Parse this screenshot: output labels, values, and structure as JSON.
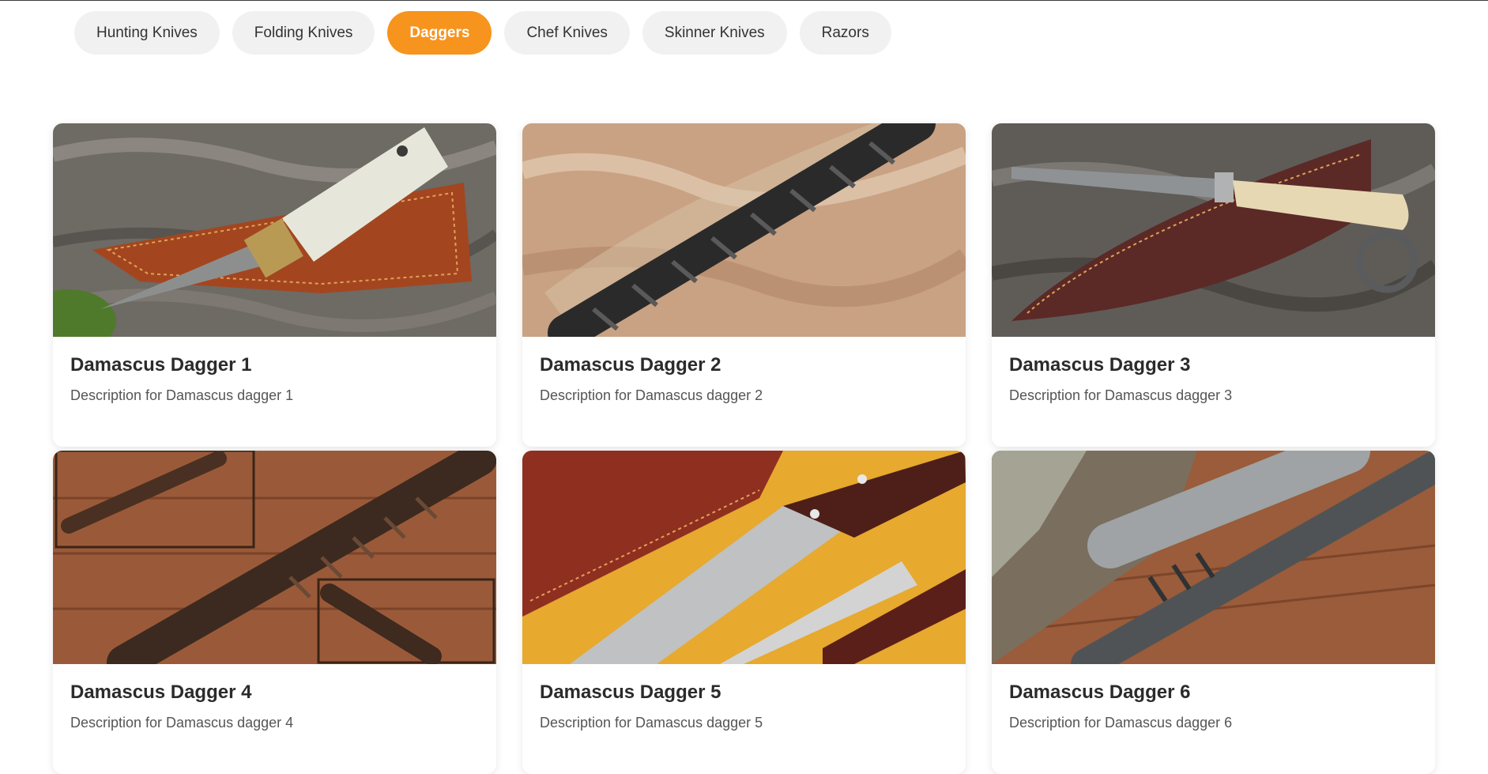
{
  "categories": [
    {
      "label": "Hunting Knives",
      "active": false
    },
    {
      "label": "Folding Knives",
      "active": false
    },
    {
      "label": "Daggers",
      "active": true
    },
    {
      "label": "Chef Knives",
      "active": false
    },
    {
      "label": "Skinner Knives",
      "active": false
    },
    {
      "label": "Razors",
      "active": false
    }
  ],
  "colors": {
    "accent": "#f7941d",
    "tab_bg": "#f1f1f1"
  },
  "products": [
    {
      "title": "Damascus Dagger 1",
      "description": "Description for Damascus dagger 1"
    },
    {
      "title": "Damascus Dagger 2",
      "description": "Description for Damascus dagger 2"
    },
    {
      "title": "Damascus Dagger 3",
      "description": "Description for Damascus dagger 3"
    },
    {
      "title": "Damascus Dagger 4",
      "description": "Description for Damascus dagger 4"
    },
    {
      "title": "Damascus Dagger 5",
      "description": "Description for Damascus dagger 5"
    },
    {
      "title": "Damascus Dagger 6",
      "description": "Description for Damascus dagger 6"
    }
  ]
}
